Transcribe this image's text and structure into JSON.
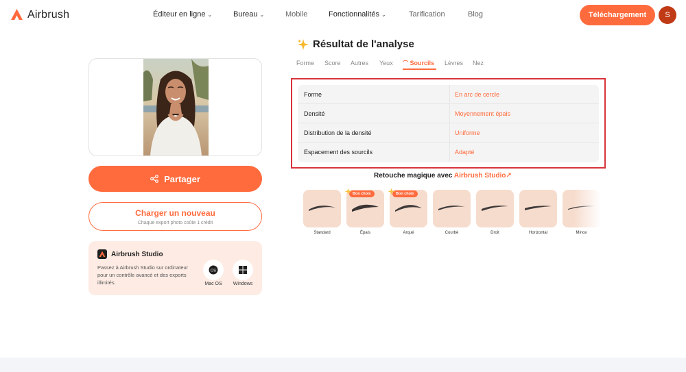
{
  "header": {
    "logo_text": "Airbrush",
    "nav": [
      {
        "label": "Éditeur en ligne",
        "has_dropdown": true
      },
      {
        "label": "Bureau",
        "has_dropdown": true
      },
      {
        "label": "Mobile",
        "has_dropdown": false
      },
      {
        "label": "Fonctionnalités",
        "has_dropdown": true
      },
      {
        "label": "Tarification",
        "has_dropdown": false
      },
      {
        "label": "Blog",
        "has_dropdown": false
      }
    ],
    "download_label": "Téléchargement",
    "avatar_initial": "S"
  },
  "left": {
    "share_label": "Partager",
    "upload_label": "Charger un nouveau",
    "upload_sub": "Chaque export photo coûte 1 crédit",
    "studio": {
      "title": "Airbrush Studio",
      "description": "Passez à Airbrush Studio sur ordinateur pour un contrôle avancé et des exports illimités.",
      "mac_label": "Mac OS",
      "windows_label": "Windows"
    }
  },
  "result": {
    "title": "Résultat de l'analyse",
    "tabs": [
      "Forme",
      "Score",
      "Autres",
      "Yeux",
      "Sourcils",
      "Lèvres",
      "Nez"
    ],
    "active_tab": "Sourcils",
    "rows": [
      {
        "key": "Forme",
        "value": "En arc de cercle"
      },
      {
        "key": "Densité",
        "value": "Moyennement épais"
      },
      {
        "key": "Distribution de la densité",
        "value": "Uniforme"
      },
      {
        "key": "Espacement des sourcils",
        "value": "Adapté"
      }
    ],
    "retouch_prefix": "Retouche magique avec",
    "retouch_link": "Airbrush Studio",
    "styles": [
      {
        "label": "Standard",
        "badge": ""
      },
      {
        "label": "Épais",
        "badge": "Bon choix"
      },
      {
        "label": "Arqué",
        "badge": "Bon choix"
      },
      {
        "label": "Courbé",
        "badge": ""
      },
      {
        "label": "Droit",
        "badge": ""
      },
      {
        "label": "Horizontal",
        "badge": ""
      },
      {
        "label": "Mince",
        "badge": ""
      }
    ]
  },
  "colors": {
    "accent": "#ff6b3d",
    "highlight_border": "#d8333a",
    "avatar": "#c03a16",
    "card_bg": "#fdebe4",
    "brow_card_bg": "#f6dccd"
  }
}
